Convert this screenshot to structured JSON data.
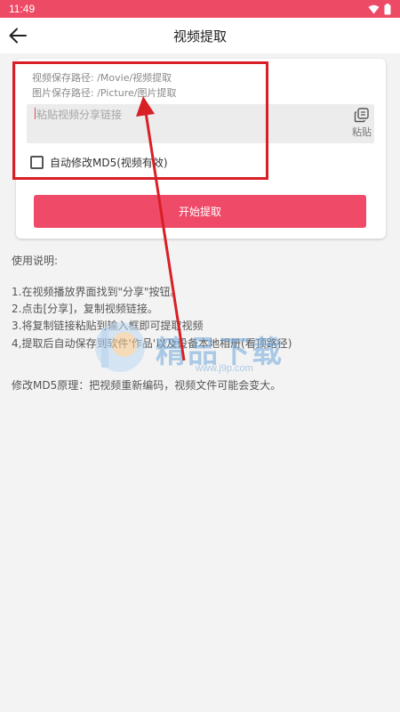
{
  "status_bar": {
    "time": "11:49",
    "icons": [
      "wifi-icon",
      "battery-icon"
    ]
  },
  "app_bar": {
    "back_icon": "arrow-left-icon",
    "title": "视频提取"
  },
  "card": {
    "video_path": "视频保存路径: /Movie/视频提取",
    "image_path": "图片保存路径: /Picture/图片提取",
    "input_placeholder": "粘贴视频分享链接",
    "input_value": "",
    "paste_icon": "clipboard-icon",
    "paste_label": "粘贴",
    "md5_checkbox_label": "自动修改MD5(视频有效)",
    "md5_checked": false,
    "start_button": "开始提取"
  },
  "instructions": {
    "title": "使用说明:",
    "steps": [
      "1.在视频播放界面找到\"分享\"按钮。",
      "2.点击[分享]，复制视频链接。",
      "3.将复制链接粘贴到输入框即可提取视频",
      "4,提取后自动保存到软件'作品'以及设备本地相册(看顶路径)"
    ],
    "md5_note": "修改MD5原理：把视频重新编码，视频文件可能会变大。"
  },
  "watermark": {
    "text": "精品下载",
    "sub": "www.j9p.com"
  },
  "colors": {
    "accent": "#ef4a67",
    "status_bar": "#ed4a66",
    "annotation": "#d81f26"
  }
}
